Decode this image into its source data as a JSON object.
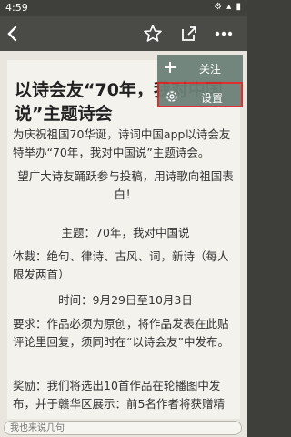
{
  "status": {
    "time": "4:59",
    "icons": "⚙ ▴ ▮"
  },
  "menu": {
    "follow_label": "关注",
    "settings_label": "设置"
  },
  "post": {
    "title": "以诗会友“70年，我对中国说”主题诗会",
    "lines": [
      "为庆祝祖国70华诞，诗词中国app以诗会友特举办“70年，我对中国说”主题诗会。",
      "望广大诗友踊跃参与投稿，用诗歌向祖国表白！",
      "主题：70年，我对中国说",
      "体裁：绝句、律诗、古风、词，新诗（每人限发两首）",
      "时间：9月29日至10月3日",
      "要求：作品必须为原创，将作品发表在此贴评论里回复，须同时在“以诗会友”中发布。",
      "奖励：我们将选出10首作品在轮播图中发布，并于赣华区展示：前5名作者将获赠精"
    ]
  },
  "reply": {
    "placeholder": "我也来说几句"
  }
}
